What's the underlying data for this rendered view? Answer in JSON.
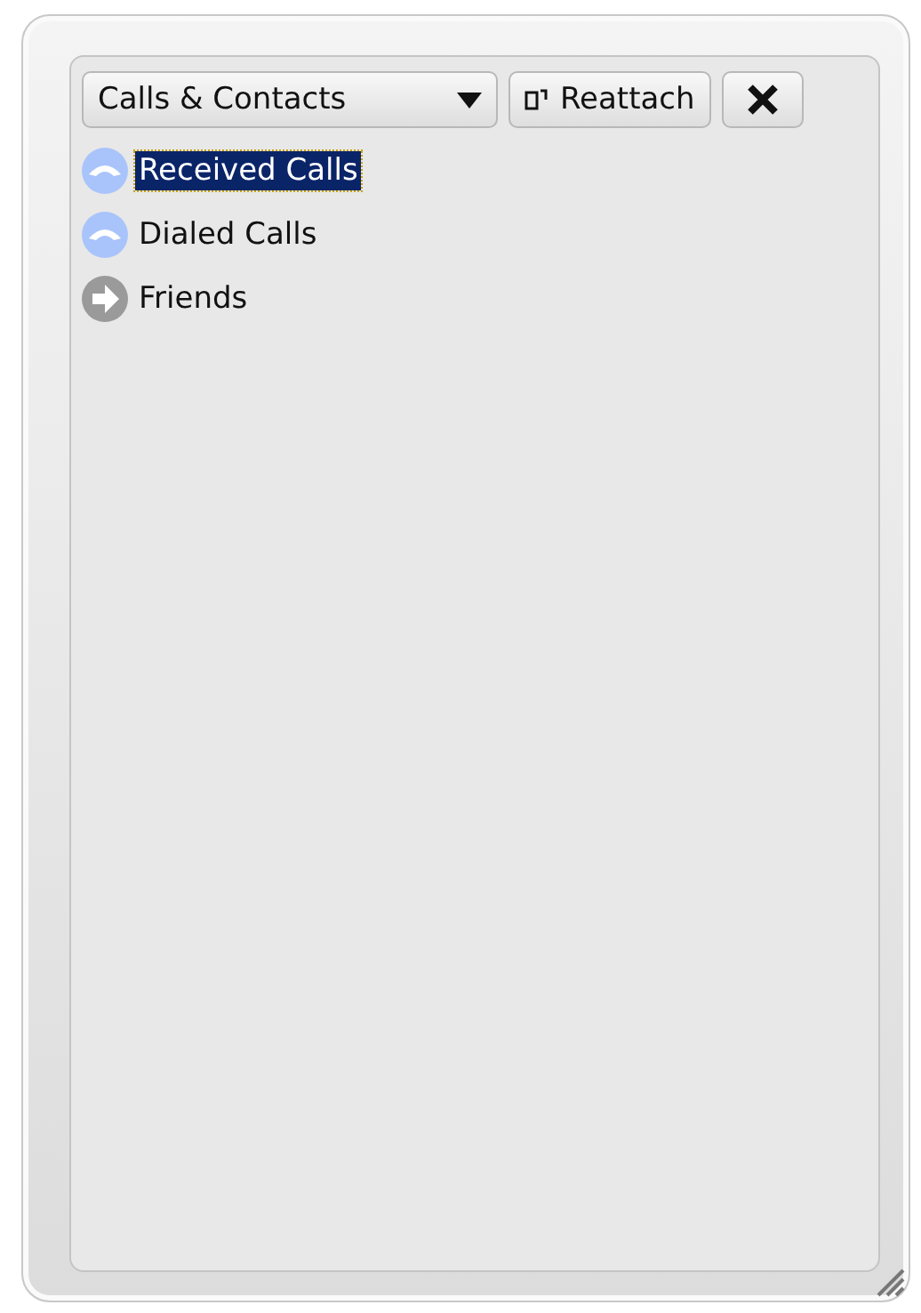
{
  "toolbar": {
    "dropdown": "Calls & Contacts",
    "reattach": "Reattach"
  },
  "items": [
    {
      "label": "Received Calls",
      "kind": "phone",
      "selected": true
    },
    {
      "label": "Dialed Calls",
      "kind": "phone",
      "selected": false
    },
    {
      "label": "Friends",
      "kind": "arrow",
      "selected": false
    }
  ]
}
